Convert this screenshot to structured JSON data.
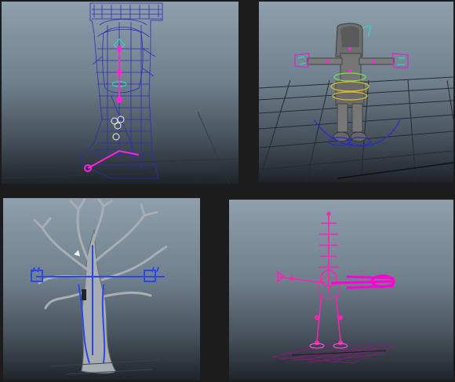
{
  "window": {
    "title": ""
  },
  "viewports": [
    {
      "id": "boot_rig",
      "label": "",
      "content": "wireframe-boot-rig"
    },
    {
      "id": "character_rig",
      "label": "",
      "content": "character-tpose-rig"
    },
    {
      "id": "tree_rig",
      "label": "",
      "content": "tree-rig"
    },
    {
      "id": "skeleton_rig",
      "label": "",
      "content": "skeleton-joints-rig"
    }
  ],
  "colors": {
    "background": "#1c1c1c",
    "viewport_gradient_top": "#8e9fad",
    "viewport_gradient_bottom": "#1f242a",
    "wireframe_blue": "#3a35c8",
    "joint_magenta": "#ff1fd0",
    "controller_cyan": "#22e0c8",
    "grid": "#2a2f34",
    "tree_gray": "#b0b5ba"
  }
}
